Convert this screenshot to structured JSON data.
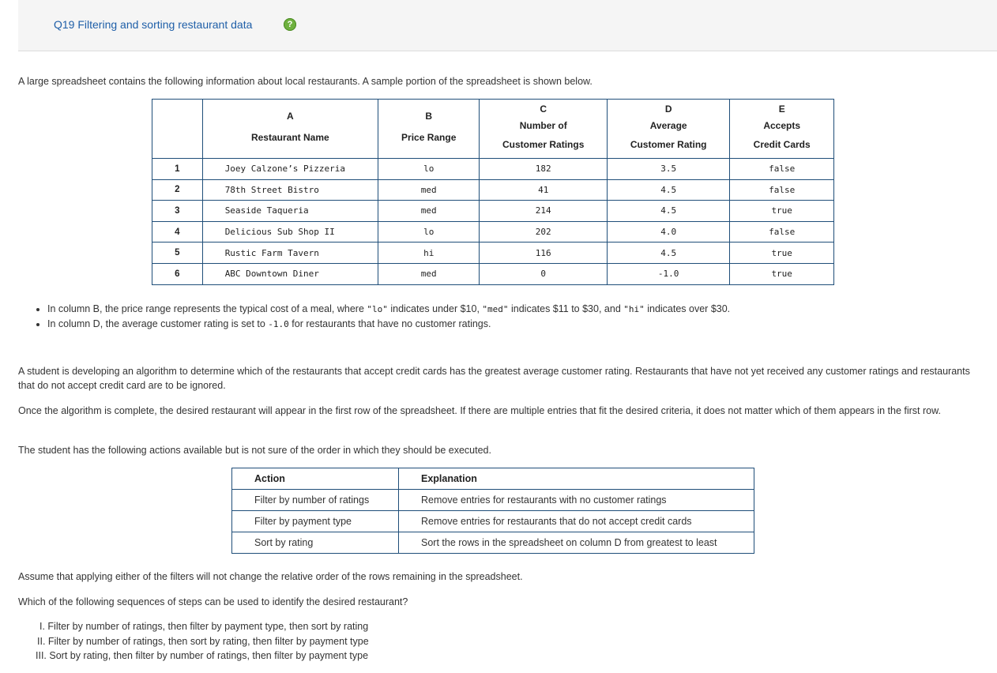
{
  "header": {
    "title": "Q19 Filtering and sorting restaurant data",
    "help_icon": "?"
  },
  "intro": "A large spreadsheet contains the following information about local restaurants. A sample portion of the spreadsheet is shown below.",
  "spreadsheet": {
    "columns": [
      {
        "letter": "A",
        "lines": [
          "Restaurant Name"
        ]
      },
      {
        "letter": "B",
        "lines": [
          "Price Range"
        ]
      },
      {
        "letter": "C",
        "lines": [
          "Number of",
          "Customer Ratings"
        ]
      },
      {
        "letter": "D",
        "lines": [
          "Average",
          "Customer Rating"
        ]
      },
      {
        "letter": "E",
        "lines": [
          "Accepts",
          "Credit Cards"
        ]
      }
    ],
    "rows": [
      {
        "num": "1",
        "name": "Joey Calzone’s Pizzeria",
        "price": "lo",
        "count": "182",
        "rating": "3.5",
        "cards": "false"
      },
      {
        "num": "2",
        "name": "78th Street Bistro",
        "price": "med",
        "count": "41",
        "rating": "4.5",
        "cards": "false"
      },
      {
        "num": "3",
        "name": "Seaside Taqueria",
        "price": "med",
        "count": "214",
        "rating": "4.5",
        "cards": "true"
      },
      {
        "num": "4",
        "name": "Delicious Sub Shop II",
        "price": "lo",
        "count": "202",
        "rating": "4.0",
        "cards": "false"
      },
      {
        "num": "5",
        "name": "Rustic Farm Tavern",
        "price": "hi",
        "count": "116",
        "rating": "4.5",
        "cards": "true"
      },
      {
        "num": "6",
        "name": "ABC Downtown Diner",
        "price": "med",
        "count": "0",
        "rating": "-1.0",
        "cards": "true"
      }
    ]
  },
  "notes": {
    "n1_a": "In column B, the price range represents the typical cost of a meal, where ",
    "n1_code1": "\"lo\"",
    "n1_b": " indicates under $10, ",
    "n1_code2": "\"med\"",
    "n1_c": " indicates $11 to $30, and ",
    "n1_code3": "\"hi\"",
    "n1_d": " indicates over $30.",
    "n2_a": "In column D, the average customer rating is set to ",
    "n2_code": "-1.0",
    "n2_b": " for restaurants that have no customer ratings."
  },
  "paragraphs": {
    "p1": "A student is developing an algorithm to determine which of the restaurants that accept credit cards has the greatest average customer rating. Restaurants that have not yet received any customer ratings and restaurants that do not accept credit card are to be ignored.",
    "p2": "Once the algorithm is complete, the desired restaurant will appear in the first row of the spreadsheet. If there are multiple entries that fit the desired criteria, it does not matter which of them appears in the first row.",
    "p3": "The student has the following actions available but is not sure of the order in which they should be executed.",
    "p4": "Assume that applying either of the filters will not change the relative order of the rows remaining in the spreadsheet.",
    "p5": "Which of the following sequences of steps can be used to identify the desired restaurant?"
  },
  "actions": {
    "header_action": "Action",
    "header_explanation": "Explanation",
    "rows": [
      {
        "action": "Filter by number of ratings",
        "explanation": "Remove entries for restaurants with no customer ratings"
      },
      {
        "action": "Filter by payment type",
        "explanation": "Remove entries for restaurants that do not accept credit cards"
      },
      {
        "action": "Sort by rating",
        "explanation": "Sort the rows in the spreadsheet on column D from greatest to least"
      }
    ]
  },
  "options": [
    "I. Filter by number of ratings, then filter by payment type, then sort by rating",
    "II. Filter by number of ratings, then sort by rating, then filter by payment type",
    "III. Sort by rating, then filter by number of ratings, then filter by payment type"
  ]
}
